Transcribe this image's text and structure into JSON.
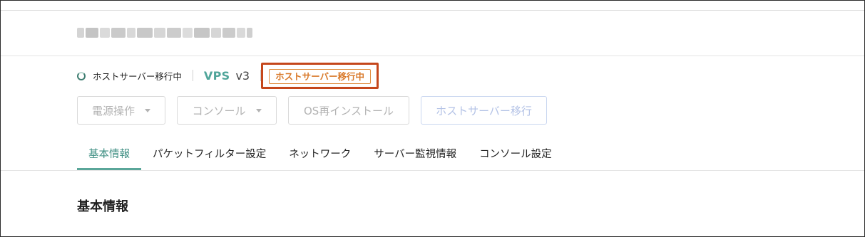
{
  "server": {
    "name_redacted": true
  },
  "status": {
    "text": "ホストサーバー移行中",
    "product": "VPS",
    "version": "v3",
    "tag": "ホストサーバー移行中",
    "tag_color": "#d97a2b",
    "highlight_color": "#c5471c"
  },
  "actions": {
    "power_label": "電源操作",
    "console_label": "コンソール",
    "reinstall_label": "OS再インストール",
    "migrate_label": "ホストサーバー移行"
  },
  "tabs": [
    {
      "label": "基本情報",
      "active": true
    },
    {
      "label": "パケットフィルター設定",
      "active": false
    },
    {
      "label": "ネットワーク",
      "active": false
    },
    {
      "label": "サーバー監視情報",
      "active": false
    },
    {
      "label": "コンソール設定",
      "active": false
    }
  ],
  "section": {
    "title": "基本情報"
  },
  "colors": {
    "accent": "#4fa59a",
    "tab_active": "#3f8f83"
  }
}
